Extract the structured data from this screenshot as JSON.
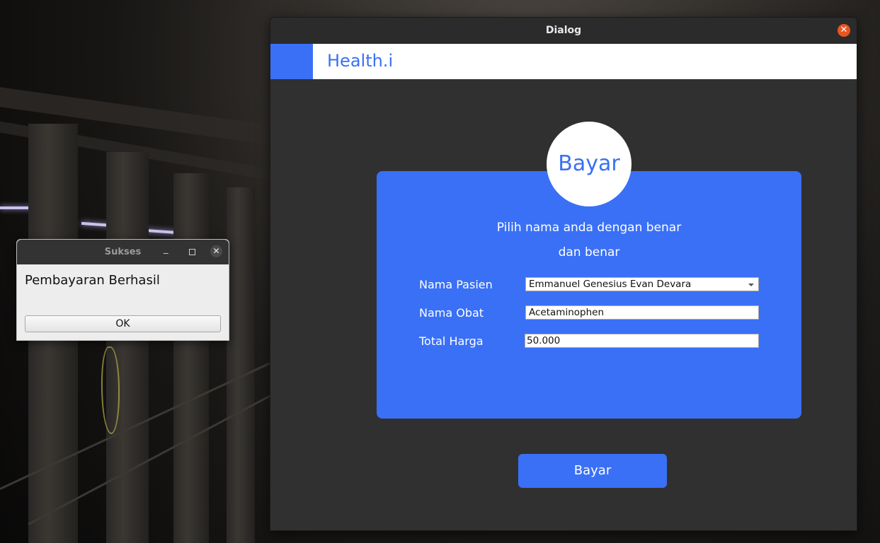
{
  "dialog": {
    "title": "Dialog",
    "close_icon": "close-icon",
    "brand": "Health.i",
    "accent_color": "#3a70f6",
    "circle_title": "Bayar",
    "instruction_line1": "Pilih nama anda dengan benar",
    "instruction_line2": "dan benar",
    "fields": [
      {
        "label": "Nama Pasien",
        "value": "Emmanuel Genesius Evan Devara",
        "type": "combobox"
      },
      {
        "label": "Nama Obat",
        "value": "Acetaminophen",
        "type": "text"
      },
      {
        "label": "Total Harga",
        "value": "50.000",
        "type": "text"
      }
    ],
    "submit_label": "Bayar"
  },
  "message_box": {
    "title": "Sukses",
    "text": "Pembayaran Berhasil",
    "ok_label": "OK",
    "close_color": "#4a4a4a"
  }
}
